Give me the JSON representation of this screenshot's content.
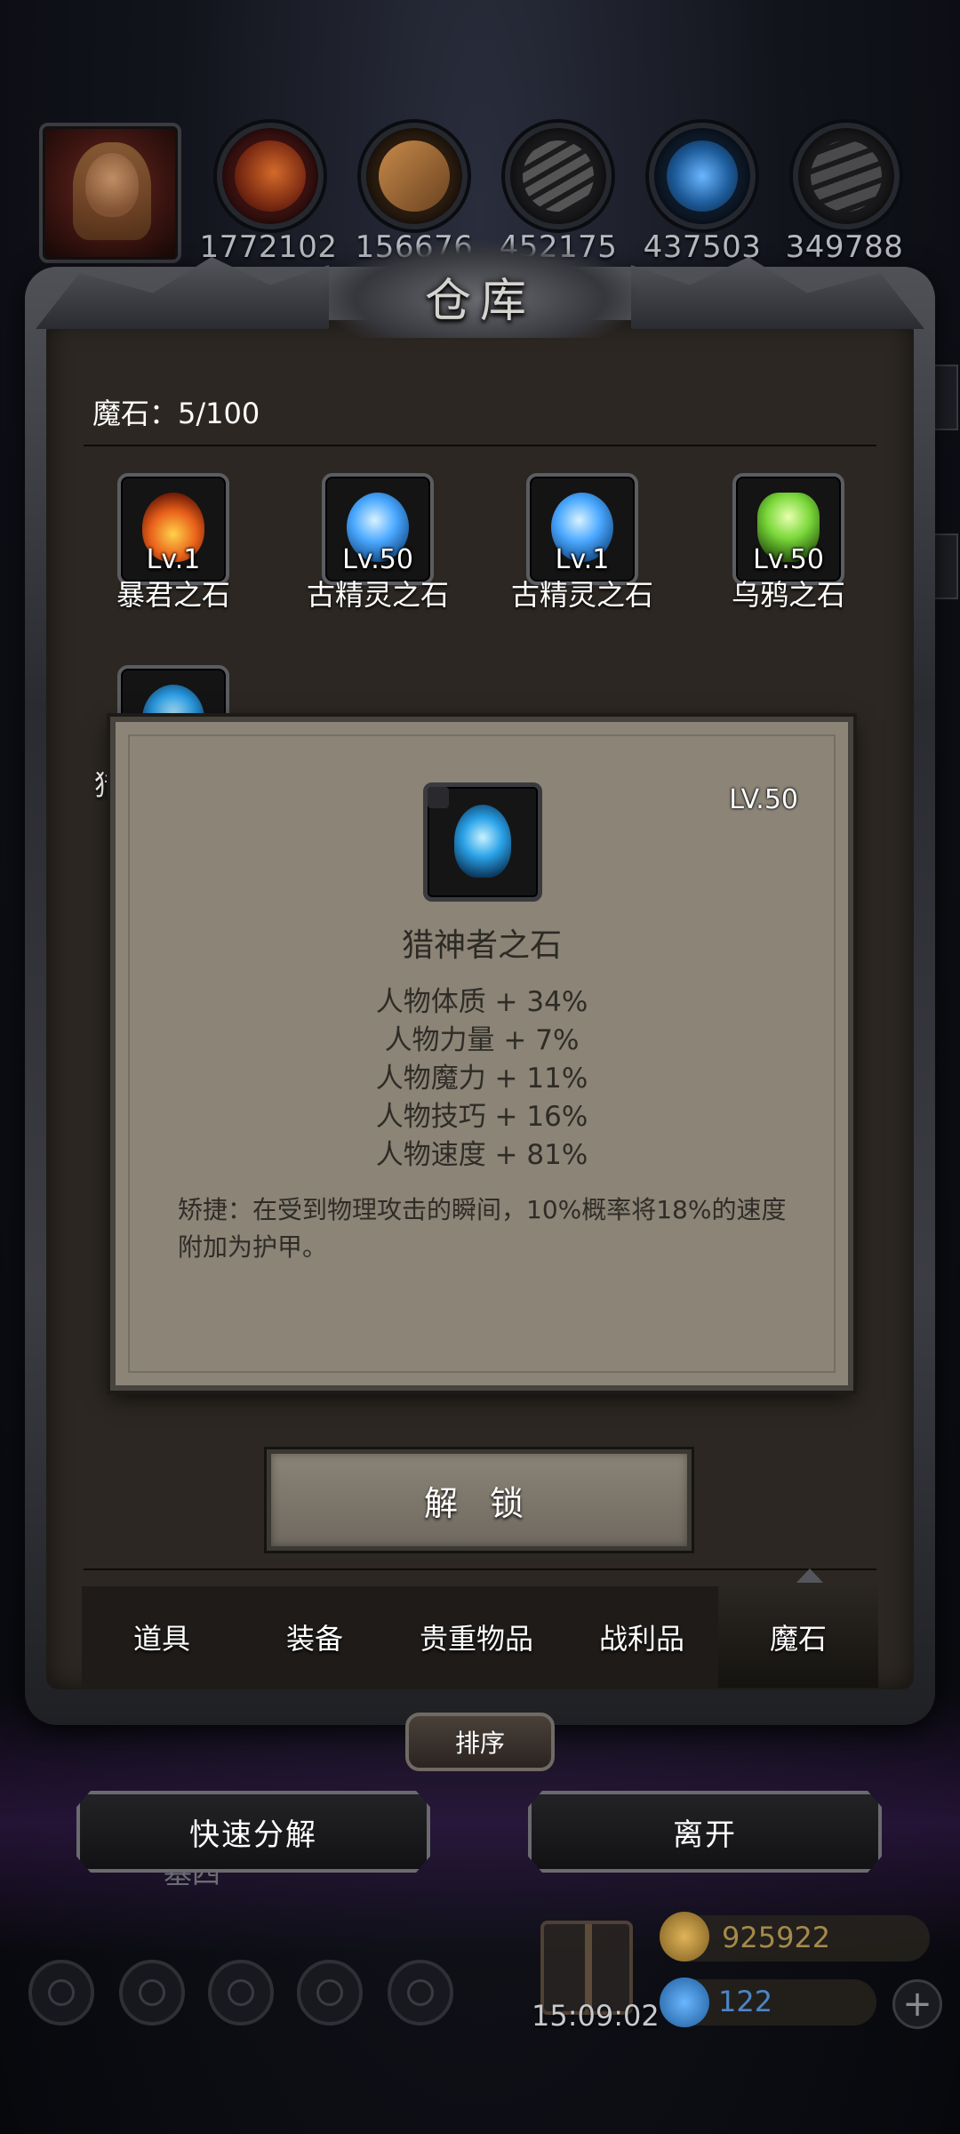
{
  "resources": {
    "values": [
      "1772102",
      "156676",
      "452175",
      "437503",
      "349788"
    ],
    "icons": [
      "meat-icon",
      "wood-icon",
      "iron-icon",
      "crystal-icon",
      "stone-icon"
    ]
  },
  "warehouse": {
    "title": "仓库",
    "stone_count": "魔石：5/100",
    "stones": [
      {
        "level": "Lv.1",
        "name": "暴君之石",
        "icon": "fire-stone-icon"
      },
      {
        "level": "Lv.50",
        "name": "古精灵之石",
        "icon": "blue-orb-icon"
      },
      {
        "level": "Lv.1",
        "name": "古精灵之石",
        "icon": "blue-orb-icon"
      },
      {
        "level": "Lv.50",
        "name": "乌鸦之石",
        "icon": "green-crystal-icon"
      },
      {
        "level": "Lv.50",
        "name": "猎神者之石",
        "icon": "blue-leaf-stone-icon"
      }
    ],
    "partial_name": "猎"
  },
  "tooltip": {
    "level": "LV.50",
    "name": "猎神者之石",
    "stats": [
      "人物体质 + 34%",
      "人物力量 + 7%",
      "人物魔力 + 11%",
      "人物技巧 + 16%",
      "人物速度 + 81%"
    ],
    "description": "矫捷：在受到物理攻击的瞬间，10%概率将18%的速度附加为护甲。"
  },
  "unlock_button": "解 锁",
  "tabs": [
    "道具",
    "装备",
    "贵重物品",
    "战利品",
    "魔石"
  ],
  "active_tab": "魔石",
  "sort_button": "排序",
  "quick_decompose_button": "快速分解",
  "leave_button": "离开",
  "hud": {
    "timer": "15:09:02",
    "gold": "925922",
    "gems": "122",
    "peek_text": "基四"
  },
  "colors": {
    "panel_bg": "#2c2722",
    "tooltip_bg": "#8b8477",
    "tooltip_text": "#2f2c27"
  }
}
